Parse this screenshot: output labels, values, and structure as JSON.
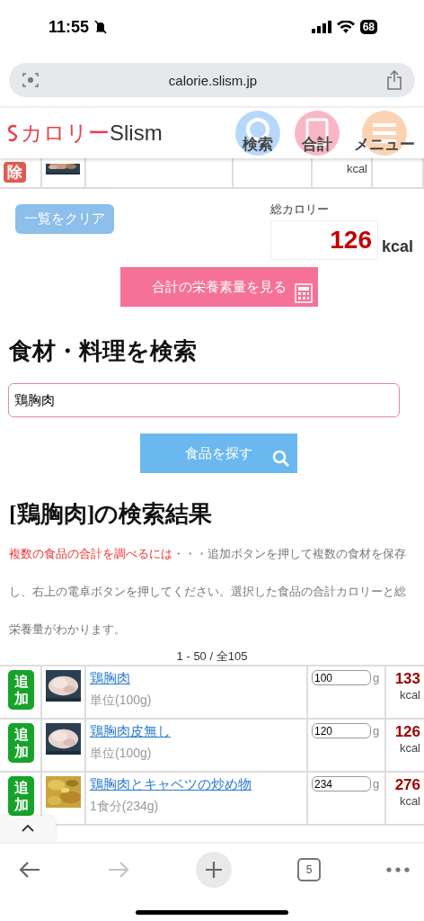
{
  "status_bar": {
    "time": "11:55",
    "battery": "68"
  },
  "browser": {
    "url": "calorie.slism.jp",
    "tab_count": "5"
  },
  "header": {
    "logo": {
      "katakana": "カロリー",
      "latin": "Slism"
    },
    "nav": [
      {
        "label": "検索",
        "kind": "search"
      },
      {
        "label": "合計",
        "kind": "calculator"
      },
      {
        "label": "メニュー",
        "kind": "menu"
      }
    ]
  },
  "saved_row": {
    "remove": "除",
    "unit": "kcal"
  },
  "clear_button": "一覧をクリア",
  "total": {
    "label": "総カロリー",
    "value": "126",
    "unit": "kcal"
  },
  "nutrition_button": "合計の栄養素量を見る",
  "search": {
    "heading": "食材・料理を検索",
    "value": "鶏胸肉",
    "button": "食品を探す"
  },
  "results": {
    "heading": "[鶏胸肉]の検索結果",
    "note_lead": "複数の食品の合計を調べるには",
    "note": "・・・追加ボタンを押して複数の食材を保存し、右上の電卓ボタンを押してください。選択した食品の合計カロリーと総栄養量がわかります。",
    "count": "1 - 50 / 全105",
    "rows": [
      {
        "add": "追加",
        "name": "鶏胸肉",
        "unit": "単位(100g)",
        "grams": "100",
        "g": "g",
        "kcal": "133",
        "kcal_unit": "kcal"
      },
      {
        "add": "追加",
        "name": "鶏胸肉皮無し",
        "unit": "単位(100g)",
        "grams": "120",
        "g": "g",
        "kcal": "126",
        "kcal_unit": "kcal"
      },
      {
        "add": "追加",
        "name": "鶏胸肉とキャベツの炒め物",
        "unit": "1食分(234g)",
        "grams": "234",
        "g": "g",
        "kcal": "276",
        "kcal_unit": "kcal"
      }
    ]
  }
}
